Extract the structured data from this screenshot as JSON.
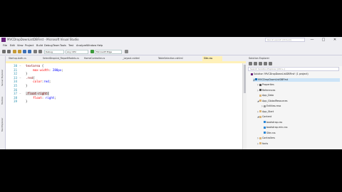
{
  "window": {
    "title": "MVCDropDownListDBFirst - Microsoft Visual Studio",
    "quick_launch": "Quick Launch (Ctrl+Q)",
    "minimize": "—",
    "maximize": "□",
    "close": "✕"
  },
  "menu": [
    "File",
    "Edit",
    "View",
    "Project",
    "Build",
    "Debug",
    "Team",
    "Tools",
    "Test",
    "Analyze",
    "Window",
    "Help"
  ],
  "toolbar": {
    "config": "Debug",
    "platform": "Any CPU",
    "browser": "Microsoft Edge"
  },
  "side_tabs": [
    "Server Explorer",
    "Toolbox",
    "Test Explorer"
  ],
  "tabs": [
    {
      "label": "Startup.Auth.cs",
      "active": false
    },
    {
      "label": "SelectDropList_ReportModels.cs",
      "active": false
    },
    {
      "label": "HomeController.cs",
      "active": false
    },
    {
      "label": "_Layout.cshtml",
      "active": false
    },
    {
      "label": "TableSelection.cshtml",
      "active": false
    },
    {
      "label": "Site.css",
      "active": true
    }
  ],
  "editor": {
    "lines": [
      {
        "num": "30",
        "parts": [
          {
            "t": "textarea",
            "c": "sel"
          },
          {
            "t": " {",
            "c": ""
          }
        ]
      },
      {
        "num": "31",
        "parts": [
          {
            "t": "    max-width",
            "c": "prop"
          },
          {
            "t": ": ",
            "c": ""
          },
          {
            "t": "280px",
            "c": "val"
          },
          {
            "t": ";",
            "c": ""
          }
        ]
      },
      {
        "num": "32",
        "parts": [
          {
            "t": "}",
            "c": ""
          }
        ]
      },
      {
        "num": "33",
        "parts": [
          {
            "t": ".red",
            "c": "sel"
          },
          {
            "t": "{",
            "c": ""
          }
        ]
      },
      {
        "num": "34",
        "parts": [
          {
            "t": "    color",
            "c": "prop"
          },
          {
            "t": ":",
            "c": ""
          },
          {
            "t": "red",
            "c": "val"
          },
          {
            "t": ";",
            "c": ""
          }
        ]
      },
      {
        "num": "35",
        "parts": [
          {
            "t": "}",
            "c": ""
          }
        ]
      },
      {
        "num": "36",
        "parts": [
          {
            "t": "",
            "c": ""
          }
        ]
      },
      {
        "num": "37",
        "parts": [
          {
            "t": ".float-right",
            "c": "sel"
          },
          {
            "t": "{",
            "c": ""
          }
        ]
      },
      {
        "num": "38",
        "parts": [
          {
            "t": "    float",
            "c": "prop"
          },
          {
            "t": ": ",
            "c": ""
          },
          {
            "t": "right",
            "c": "val"
          },
          {
            "t": ";",
            "c": ""
          }
        ]
      },
      {
        "num": "39",
        "parts": [
          {
            "t": "}",
            "c": ""
          }
        ]
      }
    ]
  },
  "solution_explorer": {
    "title": "Solution Explorer",
    "search_placeholder": "Search Solution Explorer (Ctrl+;)",
    "nodes": [
      {
        "label": "Solution 'MVCDropDownListDBFirst' (1 project)",
        "level": 0,
        "icon": "solution-icon",
        "color": "#68217a",
        "arrow": "",
        "selected": false
      },
      {
        "label": "MVCDropDownListDBFirst",
        "level": 1,
        "icon": "web-project-icon",
        "color": "#1c6fb5",
        "arrow": "◢",
        "selected": true
      },
      {
        "label": "Properties",
        "level": 2,
        "icon": "wrench-icon",
        "color": "#555555",
        "arrow": "▷",
        "selected": false
      },
      {
        "label": "References",
        "level": 2,
        "icon": "references-icon",
        "color": "#555555",
        "arrow": "▷",
        "selected": false
      },
      {
        "label": "App_Data",
        "level": 2,
        "icon": "folder-icon",
        "color": "#dcb67a",
        "arrow": "",
        "selected": false
      },
      {
        "label": "App_GlobalResources",
        "level": 2,
        "icon": "folder-icon",
        "color": "#dcb67a",
        "arrow": "◢",
        "selected": false
      },
      {
        "label": "Entities.resx",
        "level": 3,
        "icon": "resx-icon",
        "color": "#999999",
        "arrow": "▷",
        "selected": false
      },
      {
        "label": "App_Start",
        "level": 2,
        "icon": "folder-icon",
        "color": "#dcb67a",
        "arrow": "▷",
        "selected": false
      },
      {
        "label": "Content",
        "level": 2,
        "icon": "folder-icon",
        "color": "#dcb67a",
        "arrow": "◢",
        "selected": false
      },
      {
        "label": "bootstrap.css",
        "level": 3,
        "icon": "css-file-icon",
        "color": "#2b88d8",
        "arrow": "",
        "selected": false
      },
      {
        "label": "bootstrap.min.css",
        "level": 3,
        "icon": "css-file-icon",
        "color": "#2b88d8",
        "arrow": "",
        "selected": false
      },
      {
        "label": "Site.css",
        "level": 3,
        "icon": "css-file-icon",
        "color": "#2b88d8",
        "arrow": "",
        "selected": false
      },
      {
        "label": "Controllers",
        "level": 2,
        "icon": "folder-icon",
        "color": "#dcb67a",
        "arrow": "▷",
        "selected": false
      },
      {
        "label": "fonts",
        "level": 2,
        "icon": "folder-icon",
        "color": "#dcb67a",
        "arrow": "▷",
        "selected": false
      }
    ]
  }
}
